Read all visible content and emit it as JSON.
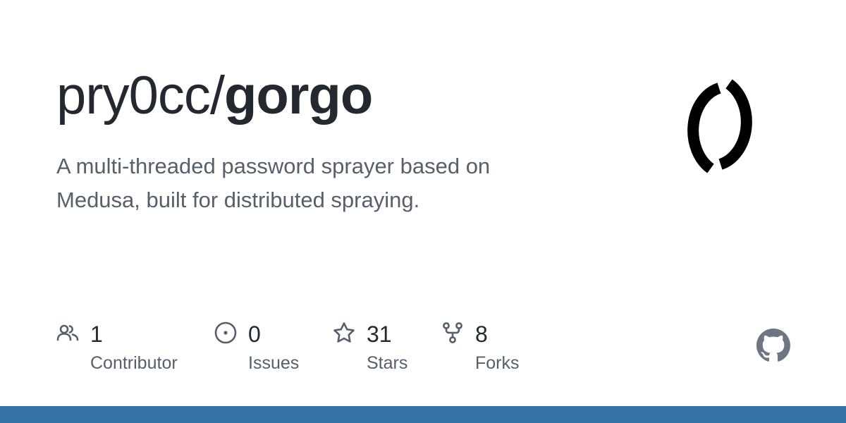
{
  "repo": {
    "owner": "pry0cc",
    "separator": "/",
    "name": "gorgo",
    "description": "A multi-threaded password sprayer based on Medusa, built for distributed spraying.",
    "avatar_icon": "circular-arrows-logo"
  },
  "stats": [
    {
      "value": "1",
      "label": "Contributor",
      "icon": "people-icon"
    },
    {
      "value": "0",
      "label": "Issues",
      "icon": "issue-opened-icon"
    },
    {
      "value": "31",
      "label": "Stars",
      "icon": "star-icon"
    },
    {
      "value": "8",
      "label": "Forks",
      "icon": "repo-forked-icon"
    }
  ],
  "brand": {
    "logo_icon": "github-mark-icon",
    "icon_color": "#57606a",
    "logo_color": "#6e7781",
    "accent_bar_color": "#3572a5"
  }
}
